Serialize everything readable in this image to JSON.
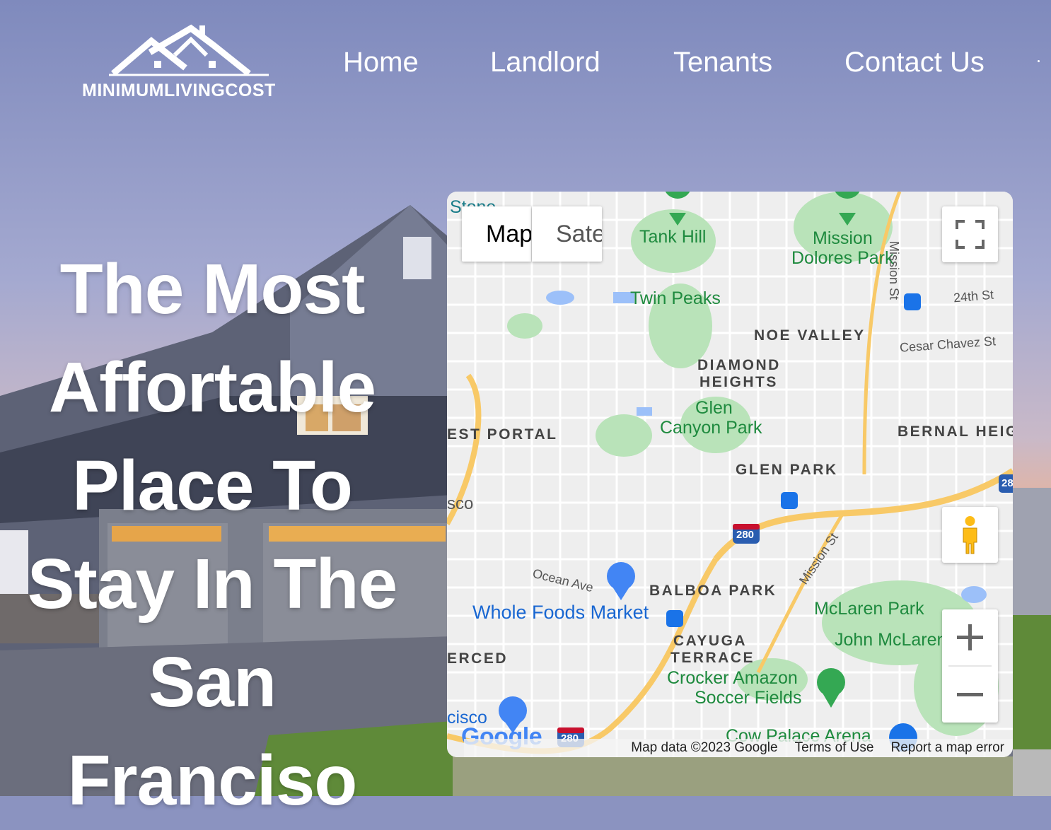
{
  "brand": {
    "logo_text": "MINIMUMLIVINGCOST"
  },
  "nav": {
    "items": [
      {
        "label": "Home"
      },
      {
        "label": "Landlord"
      },
      {
        "label": "Tenants"
      },
      {
        "label": "Contact Us"
      }
    ]
  },
  "hero": {
    "title": "The Most Affortable Place To Stay In The San Franciso"
  },
  "map": {
    "type_buttons": {
      "map": "Map",
      "satellite": "Satellite"
    },
    "labels": {
      "tank_hill": "Tank Hill",
      "mission_dolores_1": "Mission",
      "mission_dolores_2": "Dolores Park",
      "mission_st_vertical": "Mission St",
      "st_24th": "24th St",
      "twin_peaks": "Twin Peaks",
      "noe_valley": "NOE VALLEY",
      "cesar_chavez": "Cesar Chavez St",
      "diamond_1": "DIAMOND",
      "diamond_2": "HEIGHTS",
      "glen_canyon_1": "Glen",
      "glen_canyon_2": "Canyon Park",
      "west_portal": "EST PORTAL",
      "bernal": "BERNAL HEIG",
      "glen_park": "GLEN PARK",
      "sco": "sco",
      "ocean_ave": "Ocean Ave",
      "mission_st_diag": "Mission St",
      "balboa_park": "BALBOA PARK",
      "whole_foods": "Whole Foods Market",
      "mclaren_park": "McLaren Park",
      "john_mclaren": "John McLaren Park",
      "cayuga_1": "CAYUGA",
      "cayuga_2": "TERRACE",
      "erced": "ERCED",
      "crocker_1": "Crocker Amazon",
      "crocker_2": "Soccer Fields",
      "cisco": "cisco",
      "cow_palace": "Cow Palace Arena",
      "stone": "Stone",
      "highway_280": "280",
      "highway_28": "28"
    },
    "footer": {
      "data": "Map data ©2023 Google",
      "terms": "Terms of Use",
      "report": "Report a map error"
    },
    "google_logo": "Google",
    "colors": {
      "park": "#b9e3b9",
      "road": "#ffffff",
      "highway": "#f8c967",
      "water": "#9cc0f9",
      "base": "#eeeeee"
    }
  }
}
